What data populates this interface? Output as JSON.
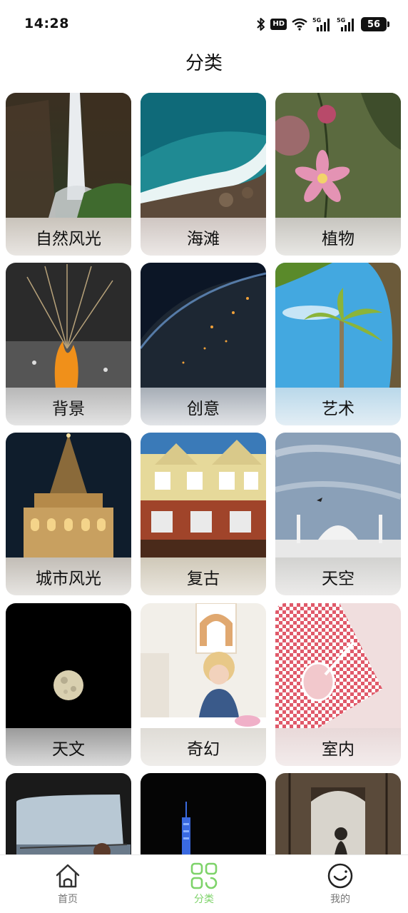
{
  "status_bar": {
    "time": "14:28",
    "battery": "56",
    "icons": [
      "bluetooth-icon",
      "hd-icon",
      "wifi-icon",
      "5g-signal-icon",
      "5g-signal-icon",
      "battery-icon"
    ]
  },
  "header": {
    "title": "分类"
  },
  "categories": [
    {
      "label": "自然风光",
      "image": "waterfall"
    },
    {
      "label": "海滩",
      "image": "ocean-aerial"
    },
    {
      "label": "植物",
      "image": "pink-flower"
    },
    {
      "label": "背景",
      "image": "orange-splash"
    },
    {
      "label": "创意",
      "image": "planet-earth-night"
    },
    {
      "label": "艺术",
      "image": "palm-trees-sky"
    },
    {
      "label": "城市风光",
      "image": "galata-tower"
    },
    {
      "label": "复古",
      "image": "vintage-building"
    },
    {
      "label": "天空",
      "image": "mosque-sky"
    },
    {
      "label": "天文",
      "image": "full-moon"
    },
    {
      "label": "奇幻",
      "image": "girl-drawing"
    },
    {
      "label": "室内",
      "image": "pink-drink"
    },
    {
      "label": "",
      "image": "car-window-view"
    },
    {
      "label": "",
      "image": "blue-tower-night"
    },
    {
      "label": "",
      "image": "ornate-gate"
    }
  ],
  "tabs": [
    {
      "label": "首页",
      "icon": "home-icon",
      "active": false
    },
    {
      "label": "分类",
      "icon": "category-grid-icon",
      "active": true
    },
    {
      "label": "我的",
      "icon": "profile-smile-icon",
      "active": false
    }
  ],
  "colors": {
    "accent": "#7ed36a",
    "text": "#111111",
    "inactive": "#777777"
  }
}
